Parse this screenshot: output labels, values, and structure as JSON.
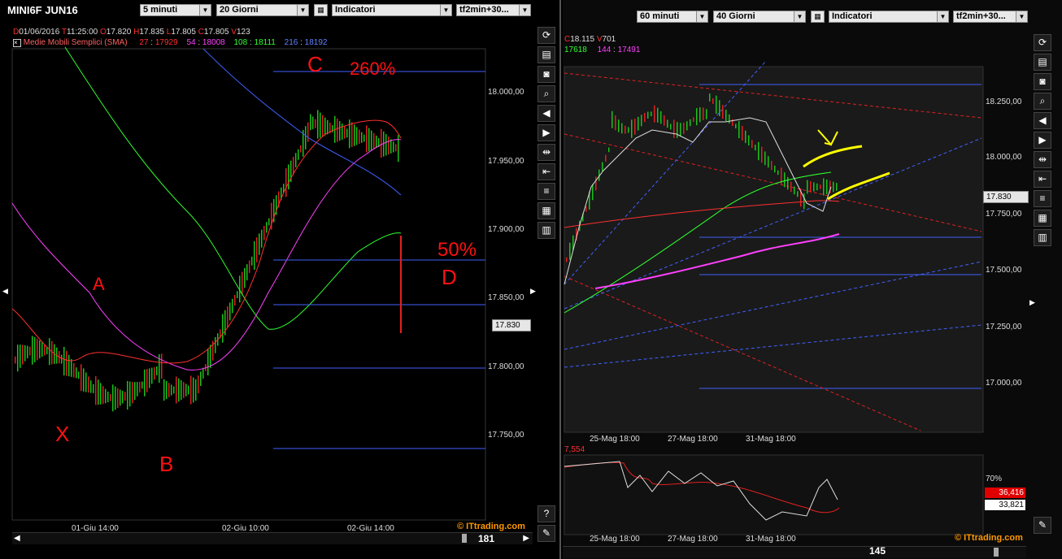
{
  "left": {
    "title": "MINI6F JUN16",
    "interval": "5 minuti",
    "range": "20 Giorni",
    "indicators": "Indicatori",
    "template": "tf2min+30...",
    "ohlc": {
      "d_label": "D",
      "date": "01/06/2016",
      "t_label": "T",
      "time": "11:25:00",
      "o_label": "O",
      "open": "17.820",
      "h_label": "H",
      "high": "17.835",
      "l_label": "L",
      "low": "17.805",
      "c_label": "C",
      "close": "17.805",
      "v_label": "V",
      "volume": "123"
    },
    "sma": {
      "label": "Medie Mobili Semplici (SMA)",
      "p1": "27",
      "v1": "17929",
      "p2": "54",
      "v2": "18008",
      "p3": "108",
      "v3": "18111",
      "p4": "216",
      "v4": "18192"
    },
    "price_labels": [
      "18.000,00",
      "17.950,00",
      "17.900,00",
      "17.850,00",
      "17.800,00",
      "17.750,00"
    ],
    "current_price": "17.830",
    "time_labels": [
      "01-Giu 14:00",
      "02-Giu 10:00",
      "02-Giu 14:00"
    ],
    "brand": "© ITtrading.com",
    "bars_count": "181",
    "annotations": {
      "c": "C",
      "c_pct": "260%",
      "a": "A",
      "b": "B",
      "x": "X",
      "d": "D",
      "d_pct": "50%"
    }
  },
  "right": {
    "interval": "60 minuti",
    "range": "40 Giorni",
    "indicators": "Indicatori",
    "template": "tf2min+30...",
    "ohlc": {
      "c_label": "C",
      "close": "18.115",
      "v_label": "V",
      "volume": "701"
    },
    "sma": {
      "v_a": "17618",
      "p_b": "144",
      "v_b": "17491"
    },
    "price_labels": [
      "18.250,00",
      "18.000,00",
      "17.750,00",
      "17.500,00",
      "17.250,00",
      "17.000,00"
    ],
    "current_price": "17.830",
    "time_labels": [
      "25-Mag 18:00",
      "27-Mag 18:00",
      "31-Mag 18:00"
    ],
    "osc_label": "7,554",
    "osc_level": "70%",
    "osc_values": [
      "36,416",
      "33,821"
    ],
    "brand": "© ITtrading.com",
    "bars_count": "145"
  },
  "colors": {
    "sma27": "#ff3030",
    "sma54": "#ff40ff",
    "sma108": "#30ff30",
    "sma216": "#4060ff",
    "up": "#19c219",
    "down": "#e02020",
    "annot": "#ff1010",
    "hilite": "#ffff00"
  },
  "icons": [
    "refresh-icon",
    "save-icon",
    "camera-icon",
    "zoom-icon",
    "back-icon",
    "forward-icon",
    "expand-icon",
    "compress-icon",
    "list-icon",
    "grid-icon",
    "notes-icon"
  ]
}
